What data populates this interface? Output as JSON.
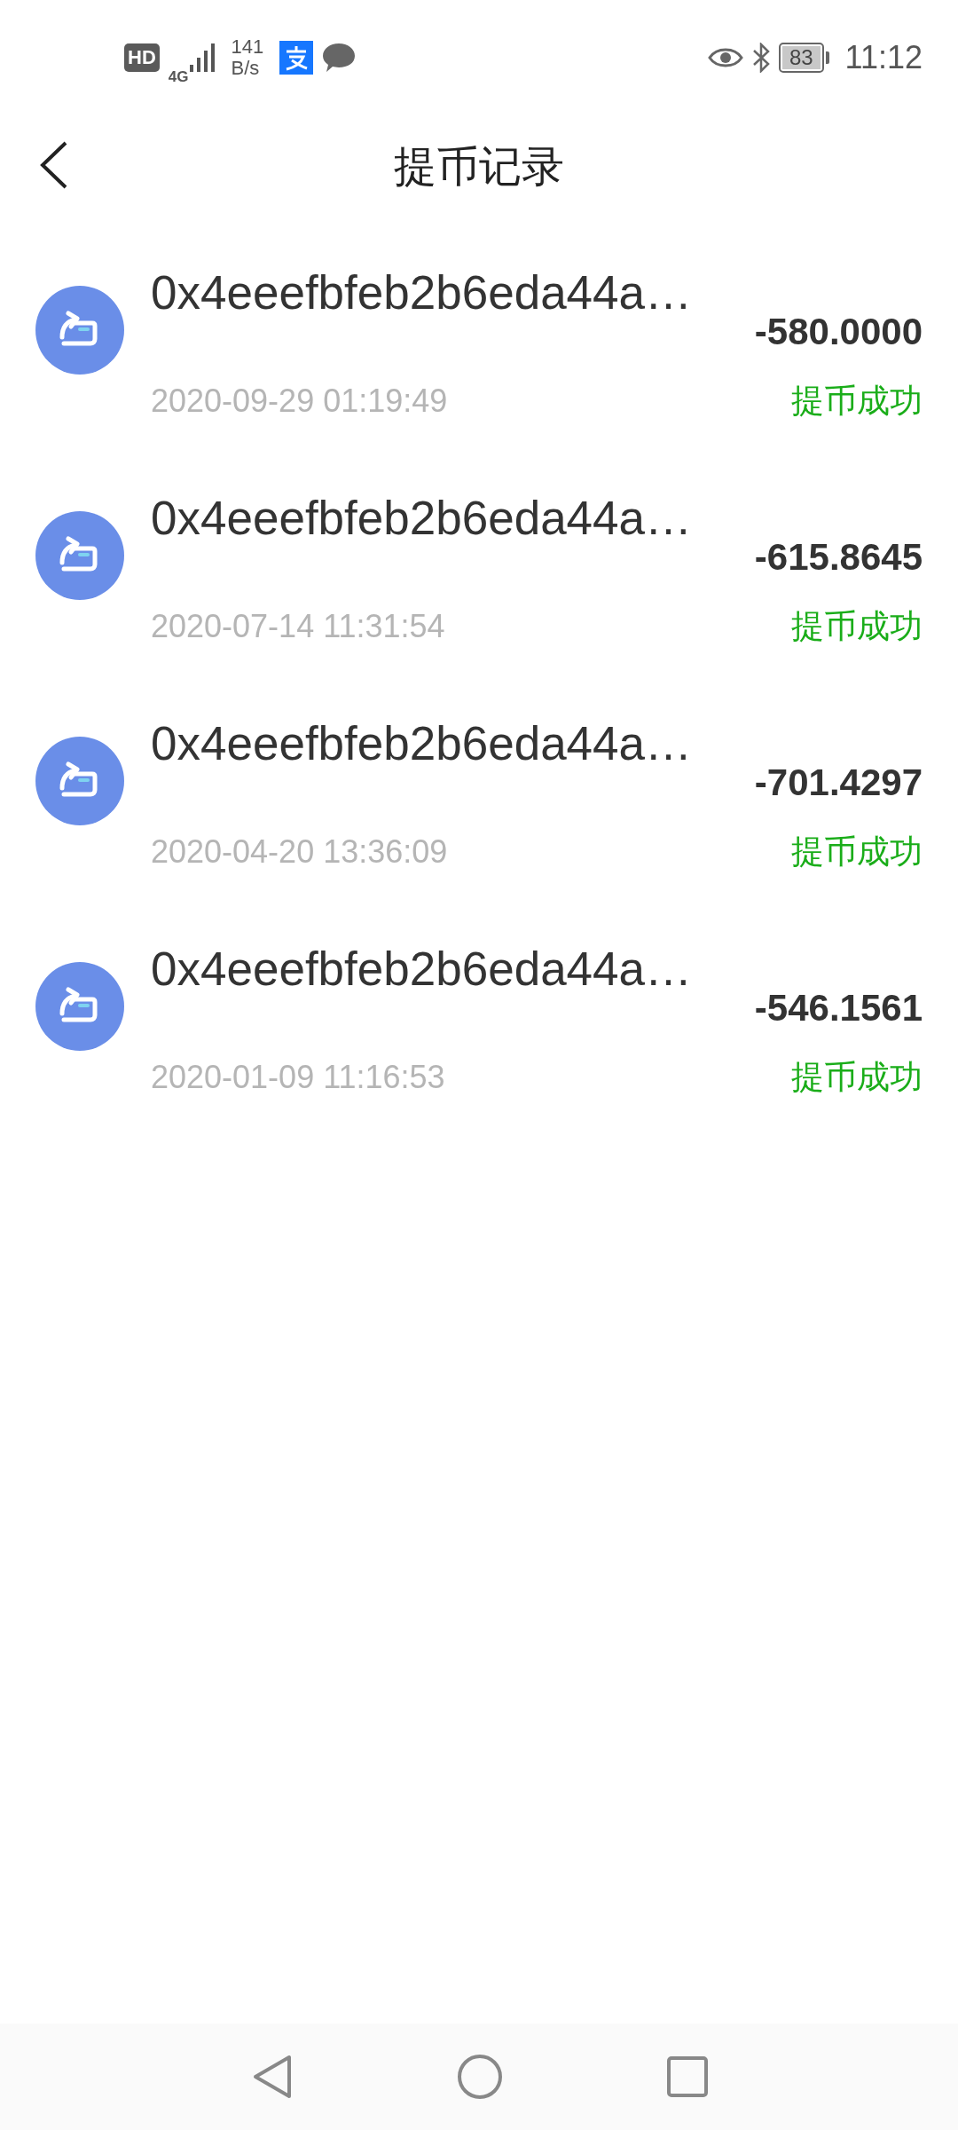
{
  "status_bar": {
    "network_badge": "HD",
    "network_type": "4G",
    "speed_value": "141",
    "speed_unit": "B/s",
    "battery": "83",
    "time": "11:12"
  },
  "header": {
    "title": "提币记录"
  },
  "records": [
    {
      "address": "0x4eeefbfeb2b6eda44a…",
      "amount": "-580.0000",
      "time": "2020-09-29 01:19:49",
      "status": "提币成功"
    },
    {
      "address": "0x4eeefbfeb2b6eda44a…",
      "amount": "-615.8645",
      "time": "2020-07-14 11:31:54",
      "status": "提币成功"
    },
    {
      "address": "0x4eeefbfeb2b6eda44a…",
      "amount": "-701.4297",
      "time": "2020-04-20 13:36:09",
      "status": "提币成功"
    },
    {
      "address": "0x4eeefbfeb2b6eda44a…",
      "amount": "-546.1561",
      "time": "2020-01-09 11:16:53",
      "status": "提币成功"
    }
  ]
}
